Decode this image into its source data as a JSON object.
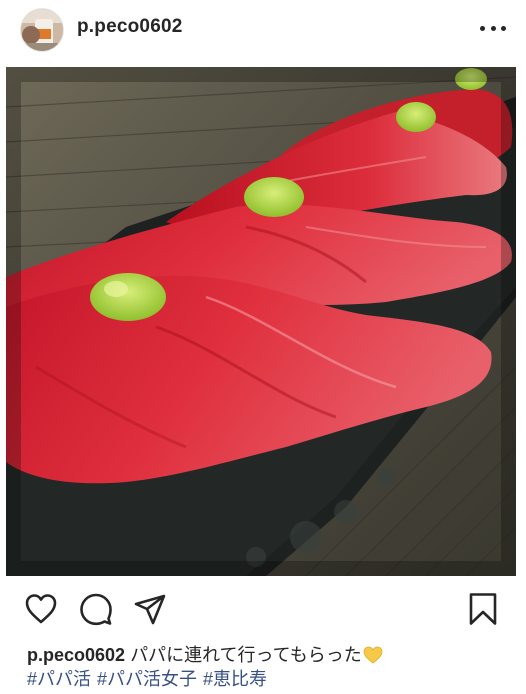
{
  "post": {
    "username": "p.peco0602",
    "caption": {
      "username": "p.peco0602",
      "text": "パパに連れて行ってもらった",
      "emoji": "yellow-heart-emoji"
    },
    "hashtags": [
      "#パパ活",
      "#パパ活女子",
      "#恵比寿"
    ],
    "icons": {
      "more": "more-options-icon",
      "like": "heart-icon",
      "comment": "comment-icon",
      "share": "paper-plane-icon",
      "save": "bookmark-icon"
    },
    "colors": {
      "text": "#262626",
      "hashtag": "#385185",
      "emoji": "#f7c948"
    }
  }
}
